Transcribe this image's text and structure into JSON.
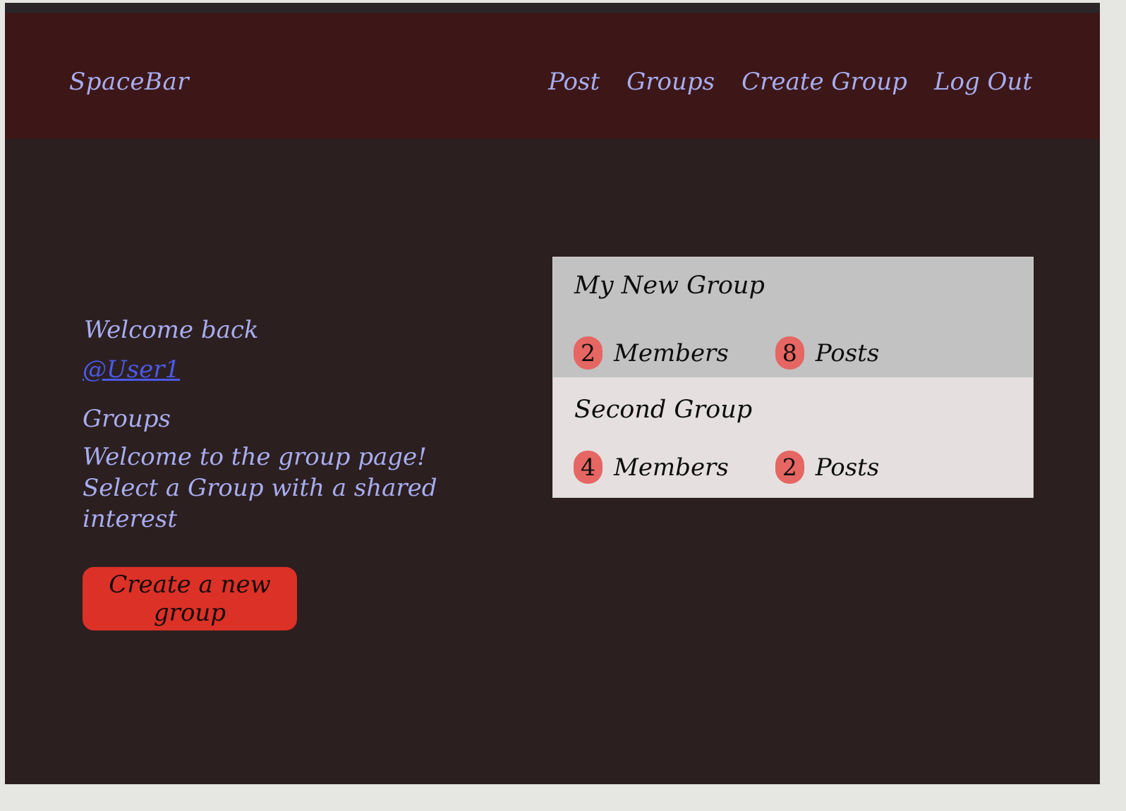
{
  "navbar": {
    "brand": "SpaceBar",
    "links": [
      "Post",
      "Groups",
      "Create Group",
      "Log Out"
    ]
  },
  "sidebar": {
    "welcome": "Welcome back",
    "username": "@User1",
    "heading": "Groups",
    "intro_line1": "Welcome to the group page!",
    "intro_line2": "Select a Group with a shared interest",
    "create_button": "Create a new group"
  },
  "groups": [
    {
      "name": "My New Group",
      "members": "2",
      "members_label": "Members",
      "posts": "8",
      "posts_label": "Posts"
    },
    {
      "name": "Second Group",
      "members": "4",
      "members_label": "Members",
      "posts": "2",
      "posts_label": "Posts"
    }
  ],
  "colors": {
    "background": "#2c1f20",
    "navbar": "#3d1718",
    "link": "#a7adef",
    "username_link": "#4a5ae8",
    "button": "#dc3127",
    "badge": "#e56662",
    "active_card": "#c2c2c2",
    "card": "#e5dfdf"
  }
}
